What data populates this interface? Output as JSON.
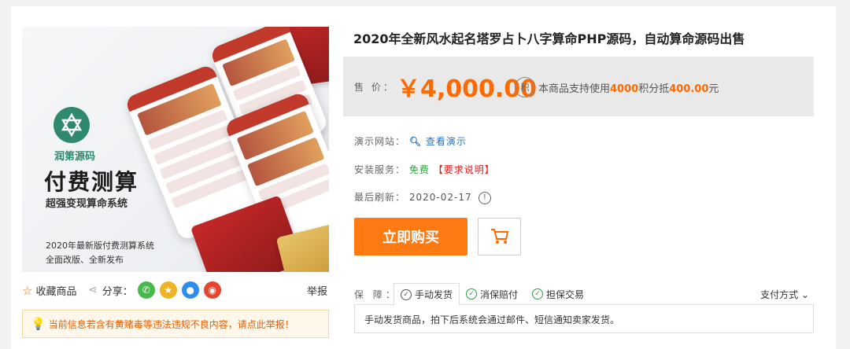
{
  "product": {
    "title": "2020年全新风水起名塔罗占卜八字算命PHP源码，自动算命源码出售",
    "hero": {
      "logo_text": "润第源码",
      "big_title": "付费测算",
      "sub_title": "超强变现算命系统",
      "foot_line1": "2020年最新版付费测算系统",
      "foot_line2": "全面改版、全新发布"
    }
  },
  "price_bar": {
    "label": "售 价：",
    "price": "￥4,000.00",
    "points_icon": "积",
    "points_prefix": "本商品支持使用",
    "points_amount": "4000",
    "points_mid": "积分抵",
    "points_value": "400.00",
    "points_suffix": "元"
  },
  "info": {
    "demo_label": "演示网站：",
    "demo_link": "查看演示",
    "install_label": "安装服务：",
    "install_value": "免费",
    "install_note": "【要求说明】",
    "refresh_label": "最后刷新：",
    "refresh_value": "2020-02-17",
    "refresh_icon": "!"
  },
  "actions": {
    "buy_label": "立即购买",
    "cart_icon": "cart-icon"
  },
  "social": {
    "fav_label": "收藏商品",
    "share_label": "分享：",
    "report_label": "举报"
  },
  "warning": {
    "text": "当前信息若含有黄赌毒等违法违规不良内容，请点此举报！"
  },
  "guarantee": {
    "label": "保 障：",
    "tabs": [
      "手动发货",
      "消保赔付",
      "担保交易"
    ],
    "pay_method": "支付方式",
    "content": "手动发货商品，拍下后系统会通过邮件、短信通知卖家发货。"
  },
  "colors": {
    "accent": "#ff6a00",
    "buy_button": "#ff7a12",
    "link": "#2a74c8",
    "green": "#2e9e3e",
    "red": "#e01d1d"
  }
}
